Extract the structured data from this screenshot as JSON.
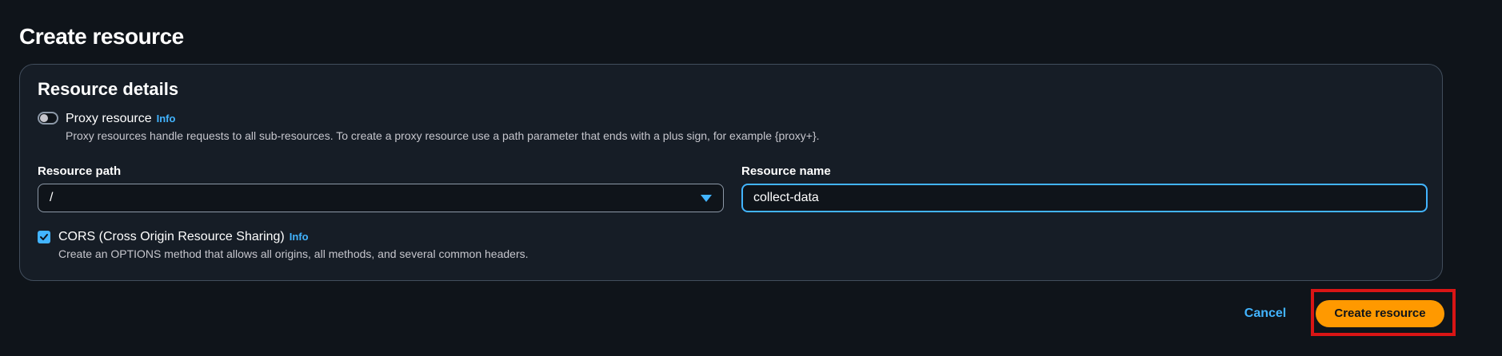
{
  "page": {
    "title": "Create resource"
  },
  "resource_details": {
    "title": "Resource details",
    "proxy": {
      "label": "Proxy resource",
      "info": "Info",
      "enabled": false,
      "description": "Proxy resources handle requests to all sub-resources. To create a proxy resource use a path parameter that ends with a plus sign, for example {proxy+}."
    },
    "resource_path": {
      "label": "Resource path",
      "value": "/"
    },
    "resource_name": {
      "label": "Resource name",
      "value": "collect-data"
    },
    "cors": {
      "label": "CORS (Cross Origin Resource Sharing)",
      "info": "Info",
      "checked": true,
      "description": "Create an OPTIONS method that allows all origins, all methods, and several common headers."
    }
  },
  "actions": {
    "cancel_label": "Cancel",
    "create_label": "Create resource"
  },
  "colors": {
    "background": "#0f141a",
    "panel": "#161d26",
    "accent_link": "#42b4ff",
    "primary_button": "#ff9900",
    "highlight": "#d91515"
  },
  "icons": {
    "toggle": "toggle-switch-icon",
    "caret": "caret-down-icon",
    "checkbox": "checkmark-icon"
  }
}
